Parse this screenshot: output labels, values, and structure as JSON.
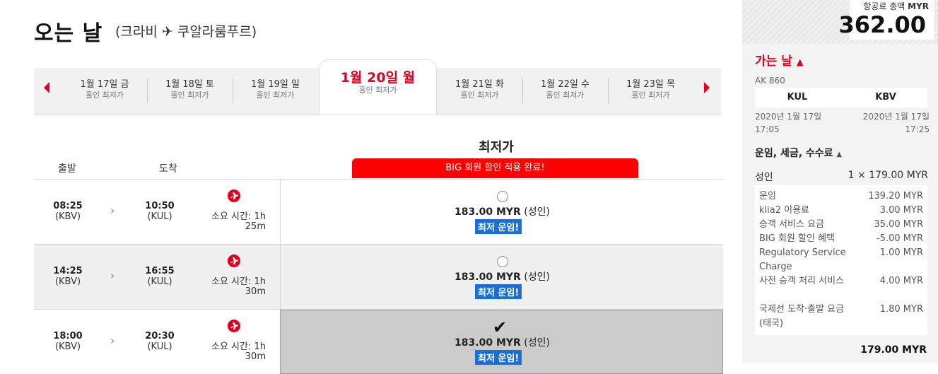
{
  "title": {
    "main": "오는 날",
    "route": "(크라비 ✈ 쿠알라룸푸르)"
  },
  "date_strip": {
    "tabs": [
      {
        "date": "1월 17일 금",
        "sub": "홀인 최저가",
        "active": false
      },
      {
        "date": "1월 18일 토",
        "sub": "홀인 최저가",
        "active": false
      },
      {
        "date": "1월 19일 일",
        "sub": "홀인 최저가",
        "active": false
      },
      {
        "date": "1월 20일 월",
        "sub": "홀인 최저가",
        "active": true
      },
      {
        "date": "1월 21일 화",
        "sub": "홀인 최저가",
        "active": false
      },
      {
        "date": "1월 22일 수",
        "sub": "홀인 최저가",
        "active": false
      },
      {
        "date": "1월 23일 목",
        "sub": "홀인 최저가",
        "active": false
      }
    ]
  },
  "list": {
    "depart_header": "출발",
    "arrive_header": "도착",
    "lowest_title": "최저가",
    "big_banner": "BIG 회원 할인 적용 완료!",
    "flights": [
      {
        "depart_time": "08:25",
        "depart_code": "(KBV)",
        "arrive_time": "10:50",
        "arrive_code": "(KUL)",
        "duration_1": "소요 시간: 1h",
        "duration_2": "25m",
        "price": "183.00 MYR",
        "pax": "(성인)",
        "badge": "최저 운임!",
        "selected": false
      },
      {
        "depart_time": "14:25",
        "depart_code": "(KBV)",
        "arrive_time": "16:55",
        "arrive_code": "(KUL)",
        "duration_1": "소요 시간: 1h",
        "duration_2": "30m",
        "price": "183.00 MYR",
        "pax": "(성인)",
        "badge": "최저 운임!",
        "selected": false
      },
      {
        "depart_time": "18:00",
        "depart_code": "(KBV)",
        "arrive_time": "20:30",
        "arrive_code": "(KUL)",
        "duration_1": "소요 시간: 1h",
        "duration_2": "30m",
        "price": "183.00 MYR",
        "pax": "(성인)",
        "badge": "최저 운임!",
        "selected": true
      }
    ]
  },
  "sidebar": {
    "total_label_prefix": "항공료 총액",
    "total_currency": "MYR",
    "total_amount": "362.00",
    "segment_title": "가는 날",
    "flight_no": "AK 860",
    "origin": "KUL",
    "destination": "KBV",
    "depart_date": "2020년 1월 17일",
    "depart_time": "17:05",
    "arrive_date": "2020년 1월 17일",
    "arrive_time": "17:25",
    "fees_title": "운임, 세금, 수수료",
    "pax_label": "성인",
    "pax_amount": "1 × 179.00 MYR",
    "fees": [
      {
        "name": "운임",
        "value": "139.20 MYR"
      },
      {
        "name": "klia2 이용료",
        "value": "3.00 MYR"
      },
      {
        "name": "승객 서비스 요금",
        "value": "35.00 MYR"
      },
      {
        "name": "BIG 회원 할인 혜택",
        "value": "-5.00 MYR"
      },
      {
        "name": "Regulatory Service Charge",
        "value": "1.00 MYR"
      },
      {
        "name": "사전 승객 처리 서비스",
        "value": "4.00 MYR"
      },
      {
        "name": "국제선 도착·출발 요금(태국)",
        "value": "1.80 MYR"
      }
    ],
    "subtotal": "179.00 MYR"
  },
  "colors": {
    "accent_red": "#e0001b",
    "badge_blue": "#1a6fd6",
    "banner_red": "#ff0000"
  },
  "icons": {
    "prev": "caret-left-icon",
    "next": "caret-right-icon",
    "airline": "airasia-plane-icon",
    "expand": "caret-up-icon"
  }
}
